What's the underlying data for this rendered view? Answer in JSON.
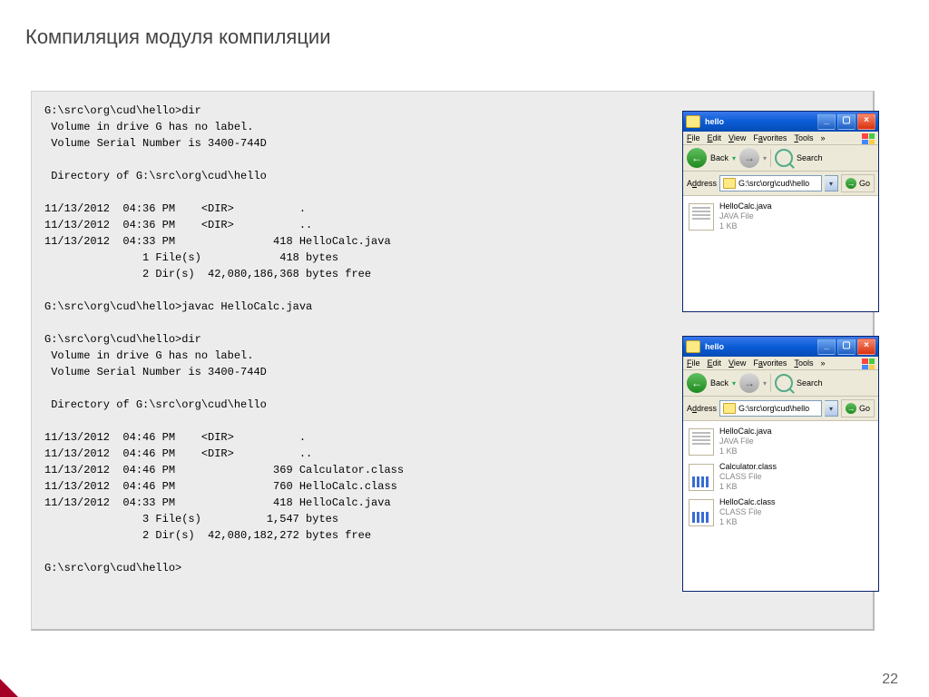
{
  "slide": {
    "title": "Компиляция модуля компиляции",
    "page_num": "22"
  },
  "code": "G:\\src\\org\\cud\\hello>dir\n Volume in drive G has no label.\n Volume Serial Number is 3400-744D\n\n Directory of G:\\src\\org\\cud\\hello\n\n11/13/2012  04:36 PM    <DIR>          .\n11/13/2012  04:36 PM    <DIR>          ..\n11/13/2012  04:33 PM               418 HelloCalc.java\n               1 File(s)            418 bytes\n               2 Dir(s)  42,080,186,368 bytes free\n\nG:\\src\\org\\cud\\hello>javac HelloCalc.java\n\nG:\\src\\org\\cud\\hello>dir\n Volume in drive G has no label.\n Volume Serial Number is 3400-744D\n\n Directory of G:\\src\\org\\cud\\hello\n\n11/13/2012  04:46 PM    <DIR>          .\n11/13/2012  04:46 PM    <DIR>          ..\n11/13/2012  04:46 PM               369 Calculator.class\n11/13/2012  04:46 PM               760 HelloCalc.class\n11/13/2012  04:33 PM               418 HelloCalc.java\n               3 File(s)          1,547 bytes\n               2 Dir(s)  42,080,182,272 bytes free\n\nG:\\src\\org\\cud\\hello>",
  "menus": {
    "file": "File",
    "edit": "Edit",
    "view": "View",
    "favorites": "Favorites",
    "tools": "Tools",
    "more": "»"
  },
  "toolbar": {
    "back": "Back",
    "search": "Search"
  },
  "addr": {
    "label": "Address",
    "path": "G:\\src\\org\\cud\\hello",
    "go": "Go"
  },
  "win1": {
    "title": "hello",
    "files": [
      {
        "name": "HelloCalc.java",
        "type": "JAVA File",
        "size": "1 KB",
        "kind": "java"
      }
    ]
  },
  "win2": {
    "title": "hello",
    "files": [
      {
        "name": "HelloCalc.java",
        "type": "JAVA File",
        "size": "1 KB",
        "kind": "java"
      },
      {
        "name": "Calculator.class",
        "type": "CLASS File",
        "size": "1 KB",
        "kind": "class"
      },
      {
        "name": "HelloCalc.class",
        "type": "CLASS File",
        "size": "1 KB",
        "kind": "class"
      }
    ]
  }
}
